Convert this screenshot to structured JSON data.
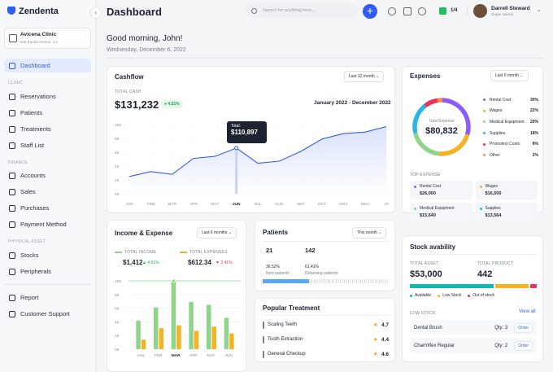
{
  "app": {
    "name": "Zendenta"
  },
  "clinic": {
    "name": "Avicena Clinic",
    "address": "845 Euclid Avenue, CA"
  },
  "nav": {
    "dashboard": "Dashboard",
    "sect_clinic": "CLINIC",
    "reservations": "Reservations",
    "patients": "Patients",
    "treatments": "Treatments",
    "staff": "Staff List",
    "sect_finance": "FINANCE",
    "accounts": "Accounts",
    "sales": "Sales",
    "purchases": "Purchases",
    "payment": "Payment Method",
    "sect_asset": "PHYSICAL ASSET",
    "stocks": "Stocks",
    "peripherals": "Peripherals",
    "report": "Report",
    "support": "Customer Support"
  },
  "header": {
    "title": "Dashboard",
    "search_placeholder": "Search for anything here...",
    "plus": "+",
    "flag_count": "1/4",
    "user_name": "Darrell Steward",
    "user_role": "Super admin"
  },
  "greeting": {
    "text": "Good morning, John!",
    "date": "Wednesday, December 6, 2022"
  },
  "cashflow": {
    "title": "Cashflow",
    "period": "Last 12 month",
    "total_label": "TOTAL CASH",
    "total": "$131,232",
    "change": "4.51%",
    "range": "January 2022 - December 2022",
    "tooltip_label": "Total:",
    "tooltip_value": "$110,897"
  },
  "chart_data": [
    {
      "type": "area",
      "title": "Cashflow",
      "categories": [
        "JAN",
        "FEB",
        "MAR",
        "APR",
        "MAY",
        "JUN",
        "JUL",
        "AUG",
        "SEP",
        "OCT",
        "NOV",
        "DEC",
        "JA"
      ],
      "yticks": [
        "10K",
        "8K",
        "6K",
        "4K",
        "2K",
        "0K"
      ],
      "ylim": [
        0,
        10
      ],
      "values": [
        2.5,
        3.2,
        2.8,
        5.1,
        5.4,
        6.6,
        4.4,
        4.7,
        6.1,
        7.9,
        8.7,
        8.9,
        9.7
      ],
      "highlight": "JUN"
    },
    {
      "type": "bar",
      "title": "Income & Expense",
      "categories": [
        "JAN",
        "FEB",
        "MAR",
        "APR",
        "MAY",
        "JUN"
      ],
      "yticks": [
        "10K",
        "8K",
        "6K",
        "4K",
        "2K",
        "0K"
      ],
      "ylim": [
        0,
        10
      ],
      "series": [
        {
          "name": "TOTAL INCOME",
          "color": "#8fd48a",
          "values": [
            4.2,
            6.1,
            10,
            6.9,
            6.5,
            4.6
          ]
        },
        {
          "name": "TOTAL EXPENSES",
          "color": "#f5b223",
          "values": [
            1.4,
            3.1,
            3.5,
            2.7,
            3.3,
            2.3
          ]
        }
      ],
      "highlight": "MAR"
    },
    {
      "type": "pie",
      "title": "Expenses",
      "total_label": "Total Expense",
      "total": "$80,832",
      "slices": [
        {
          "name": "Rental Cost",
          "pct": "30%",
          "color": "#8b5cf6",
          "value": 30
        },
        {
          "name": "Wages",
          "pct": "22%",
          "color": "#f5b223",
          "value": 22
        },
        {
          "name": "Medical Equipment",
          "pct": "20%",
          "color": "#8fd48a",
          "value": 20
        },
        {
          "name": "Supplies",
          "pct": "18%",
          "color": "#2bb7e5",
          "value": 18
        },
        {
          "name": "Promotion Costs",
          "pct": "8%",
          "color": "#e8345a",
          "value": 8
        },
        {
          "name": "Other",
          "pct": "2%",
          "color": "#ff8a3d",
          "value": 2
        }
      ]
    }
  ],
  "income": {
    "title": "Income & Expense",
    "period": "Last 6 months",
    "income_label": "TOTAL INCOME",
    "income_value": "$1,412",
    "income_change": "4.51%",
    "expense_label": "TOTAL EXPENSES",
    "expense_value": "$612.34",
    "expense_change": "2.41%"
  },
  "patients": {
    "title": "Patients",
    "period": "This month",
    "new_count": "21",
    "new_pct": "36.52%",
    "new_label": "New patients",
    "ret_count": "142",
    "ret_pct": "61.41%",
    "ret_label": "Returning patients",
    "new_fill": 0.37
  },
  "treatment": {
    "title": "Popular Treatment",
    "items": [
      {
        "name": "Scaling Teeth",
        "rating": "4.7"
      },
      {
        "name": "Tooth Extraction",
        "rating": "4.4"
      },
      {
        "name": "General Checkup",
        "rating": "4.6"
      }
    ]
  },
  "expenses": {
    "title": "Expenses",
    "period": "Last 6 month",
    "top_label": "TOP EXPENSE",
    "top": [
      {
        "name": "Rental Cost",
        "value": "$26,000",
        "color": "#8b5cf6"
      },
      {
        "name": "Wages",
        "value": "$16,500",
        "color": "#f5b223"
      },
      {
        "name": "Medical Equipment",
        "value": "$15,640",
        "color": "#8fd48a"
      },
      {
        "name": "Supplies",
        "value": "$13,564",
        "color": "#2bb7e5"
      }
    ]
  },
  "stock": {
    "title": "Stock avability",
    "asset_label": "TOTAL ASSET",
    "asset": "$53,000",
    "product_label": "TOTAL PRODUCT",
    "product": "442",
    "legend": [
      {
        "name": "Available",
        "color": "#14b8b0",
        "share": 0.68
      },
      {
        "name": "Low Stock",
        "color": "#f5b223",
        "share": 0.27
      },
      {
        "name": "Out of stock",
        "color": "#e8345a",
        "share": 0.05
      }
    ],
    "low_label": "LOW STOCK",
    "view_all": "View all",
    "items": [
      {
        "name": "Dental Brush",
        "qty": "Qty: 3",
        "action": "Order"
      },
      {
        "name": "Charmflex Regular",
        "qty": "Qty: 2",
        "action": "Order"
      }
    ]
  }
}
